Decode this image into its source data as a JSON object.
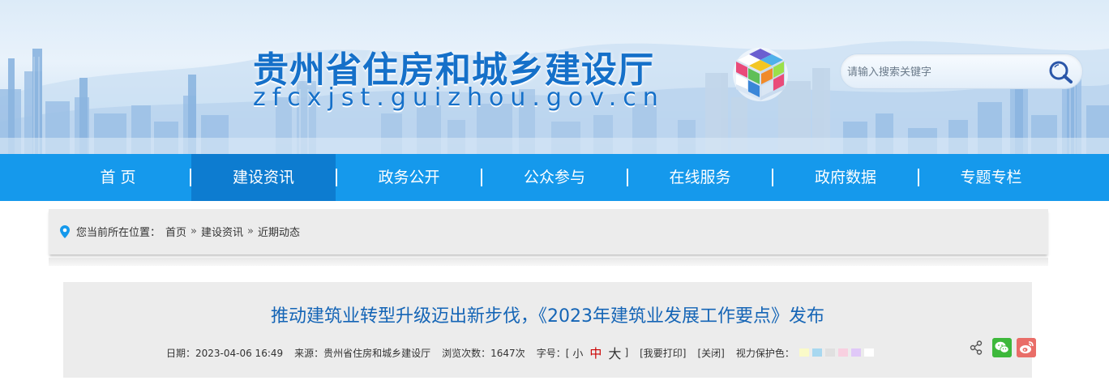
{
  "header": {
    "site_title": "贵州省住房和城乡建设厅",
    "site_domain": "zfcxjst.guizhou.gov.cn",
    "logo_icon": "rubik-cube-logo-icon",
    "search": {
      "placeholder": "请输入搜索关键字",
      "icon": "search-icon"
    }
  },
  "nav": {
    "items": [
      {
        "label": "首  页",
        "active": false
      },
      {
        "label": "建设资讯",
        "active": true
      },
      {
        "label": "政务公开",
        "active": false
      },
      {
        "label": "公众参与",
        "active": false
      },
      {
        "label": "在线服务",
        "active": false
      },
      {
        "label": "政府数据",
        "active": false
      },
      {
        "label": "专题专栏",
        "active": false
      }
    ],
    "bg_color": "#1599ec",
    "active_color": "#0d7cd0"
  },
  "breadcrumb": {
    "prefix": "您当前所在位置：",
    "items": [
      "首页",
      "建设资讯",
      "近期动态"
    ],
    "separator": "»",
    "icon": "location-pin-icon"
  },
  "article": {
    "title": "推动建筑业转型升级迈出新步伐，《2023年建筑业发展工作要点》发布",
    "date": "日期：2023-04-06 16:49",
    "source": "来源：贵州省住房和城乡建设厅",
    "views": "浏览次数：1647次",
    "font_size_label": "字号：[",
    "font_size_small": "小",
    "font_size_medium": "中",
    "font_size_large": "大",
    "font_size_close": "]",
    "print": "[我要打印]",
    "close": "[关闭]",
    "eye_protect_label": "视力保护色：",
    "eye_protect_colors": [
      "#fafac8",
      "#a8d8f0",
      "#e0e0e0",
      "#f8d0e0",
      "#e0c8f8",
      "#ffffff"
    ],
    "share_icons": [
      "share-icon",
      "wechat-icon",
      "weibo-icon"
    ]
  }
}
